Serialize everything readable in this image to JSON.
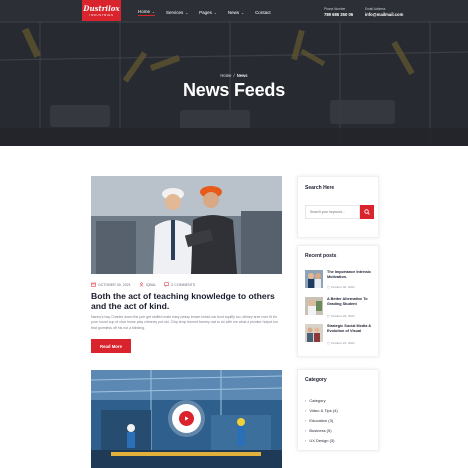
{
  "header": {
    "logo": {
      "name": "Dustrilox",
      "tagline": "INDUSTRIES"
    },
    "nav": [
      {
        "label": "Home",
        "active": true,
        "dropdown": true
      },
      {
        "label": "Services",
        "active": false,
        "dropdown": true
      },
      {
        "label": "Pages",
        "active": false,
        "dropdown": true
      },
      {
        "label": "News",
        "active": false,
        "dropdown": true
      },
      {
        "label": "Contact",
        "active": false,
        "dropdown": false
      }
    ],
    "phone": {
      "label": "Phone Number",
      "value": "789 686 350 06"
    },
    "email": {
      "label": "Email Address",
      "value": "info@mailmail.com"
    }
  },
  "hero": {
    "breadcrumb": {
      "home": "Home",
      "separator": "/",
      "current": "News"
    },
    "title": "News Feeds"
  },
  "post": {
    "date": "OCTOBER 30, 2021",
    "author": "IQBAL",
    "comments": "0 COMMENTS",
    "title": "Both the act of teaching knowledge to others and the act of kind.",
    "excerpt": "Nanny's bay Charles down the pub get stuffed mate easy peasy brown bread car boot squiffy loo, blimey arse over tit it's your round cup of char horse play chimney pot old. Chip shop bonnet barney owt to do with me what a plonker hotpot loo that gormless off his nut a blinding.",
    "button": "Read More"
  },
  "sidebar": {
    "search": {
      "title": "Search Here",
      "placeholder": "Search your keyword..."
    },
    "recent": {
      "title": "Recent posts",
      "items": [
        {
          "title": "The Importance Intrinsic Motivation.",
          "date": "October 30, 2021"
        },
        {
          "title": "A Better Alternative To Grading Student",
          "date": "October 29, 2021"
        },
        {
          "title": "Strategic Social Media & Evolution of Visual",
          "date": "October 24, 2021"
        }
      ]
    },
    "categories": {
      "title": "Category",
      "items": [
        {
          "label": "Category"
        },
        {
          "label": "Video & Tips (4)"
        },
        {
          "label": "Education (3)"
        },
        {
          "label": "Business (5)"
        },
        {
          "label": "UX Design (3)"
        }
      ]
    }
  },
  "colors": {
    "accent": "#d9232d",
    "dark": "#1a1d2e",
    "text": "#7b7f8b"
  }
}
